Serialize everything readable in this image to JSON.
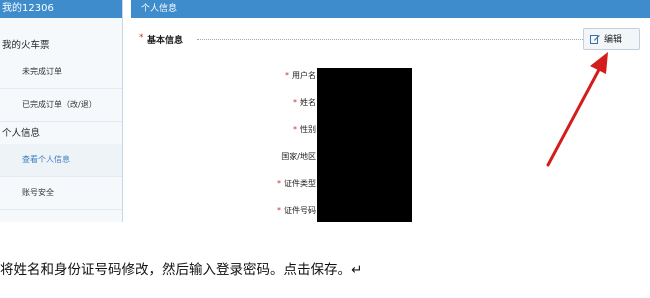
{
  "sidebar": {
    "title": "我的12306",
    "section1": "我的火车票",
    "items1": [
      "未完成订单",
      "已完成订单（改/退）"
    ],
    "section2": "个人信息",
    "items2": [
      "查看个人信息",
      "账号安全"
    ]
  },
  "main": {
    "header": "个人信息",
    "section_title": "基本信息",
    "edit_label": "编辑",
    "fields": [
      {
        "label": "用户名：",
        "required": "*"
      },
      {
        "label": "姓名：",
        "required": "*"
      },
      {
        "label": "性别：",
        "required": "*"
      },
      {
        "label": "国家/地区：",
        "required": ""
      },
      {
        "label": "证件类型：",
        "required": "*"
      },
      {
        "label": "证件号码：",
        "required": "*"
      }
    ]
  },
  "caption": "将姓名和身份证号码修改，然后输入登录密码。点击保存。↵",
  "colors": {
    "header_blue": "#3e8ccc",
    "arrow_red": "#d41c1c",
    "required_red": "#c83232"
  }
}
